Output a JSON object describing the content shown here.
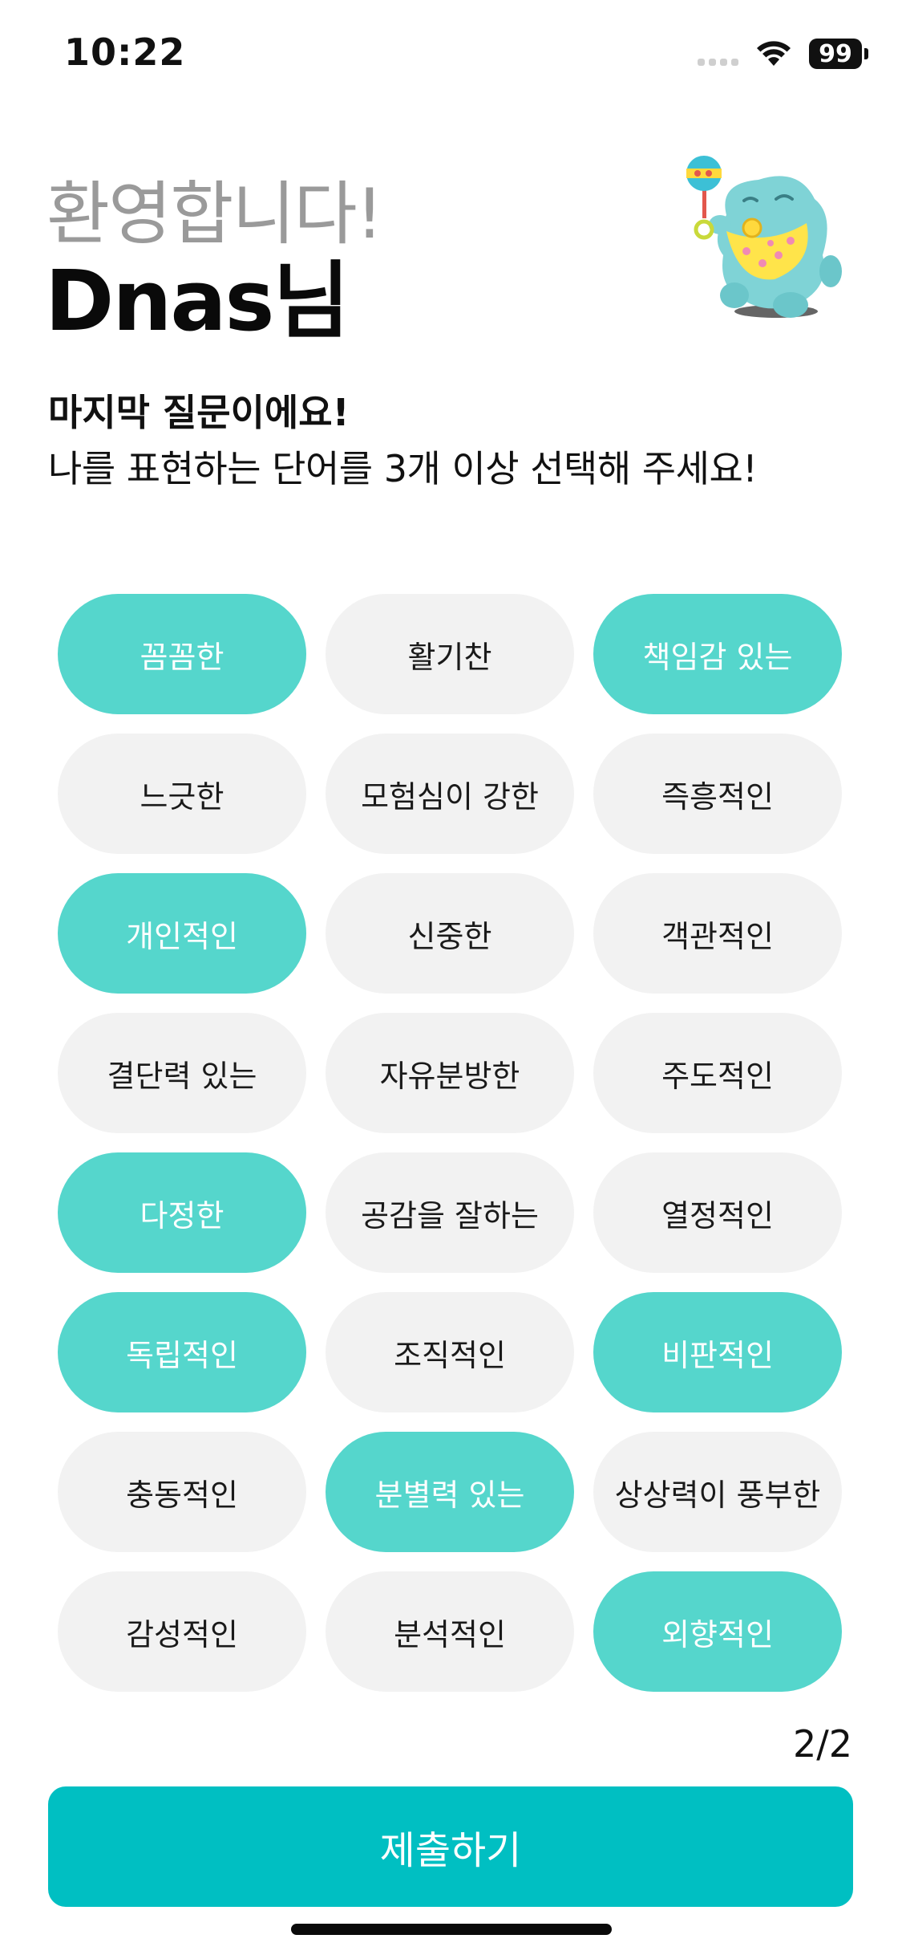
{
  "status_bar": {
    "time": "10:22",
    "battery": "99",
    "icons": [
      "signal-icon",
      "wifi-icon",
      "battery-icon"
    ]
  },
  "header": {
    "welcome": "환영합니다!",
    "user_name": "Dnas님"
  },
  "question": {
    "title": "마지막 질문이에요!",
    "subtitle": "나를 표현하는 단어를 3개 이상 선택해 주세요!"
  },
  "chips": [
    {
      "label": "꼼꼼한",
      "selected": true
    },
    {
      "label": "활기찬",
      "selected": false
    },
    {
      "label": "책임감 있는",
      "selected": true
    },
    {
      "label": "느긋한",
      "selected": false
    },
    {
      "label": "모험심이 강한",
      "selected": false
    },
    {
      "label": "즉흥적인",
      "selected": false
    },
    {
      "label": "개인적인",
      "selected": true
    },
    {
      "label": "신중한",
      "selected": false
    },
    {
      "label": "객관적인",
      "selected": false
    },
    {
      "label": "결단력 있는",
      "selected": false
    },
    {
      "label": "자유분방한",
      "selected": false
    },
    {
      "label": "주도적인",
      "selected": false
    },
    {
      "label": "다정한",
      "selected": true
    },
    {
      "label": "공감을 잘하는",
      "selected": false
    },
    {
      "label": "열정적인",
      "selected": false
    },
    {
      "label": "독립적인",
      "selected": true
    },
    {
      "label": "조직적인",
      "selected": false
    },
    {
      "label": "비판적인",
      "selected": true
    },
    {
      "label": "충동적인",
      "selected": false
    },
    {
      "label": "분별력 있는",
      "selected": true
    },
    {
      "label": "상상력이 풍부한",
      "selected": false
    },
    {
      "label": "감성적인",
      "selected": false
    },
    {
      "label": "분석적인",
      "selected": false
    },
    {
      "label": "외향적인",
      "selected": true
    }
  ],
  "page_indicator": "2/2",
  "submit_label": "제출하기",
  "colors": {
    "chip_selected": "#55d6cc",
    "chip_unselected": "#f2f2f2",
    "submit_button": "#00bfc2",
    "welcome_text": "#9a9a9a"
  }
}
